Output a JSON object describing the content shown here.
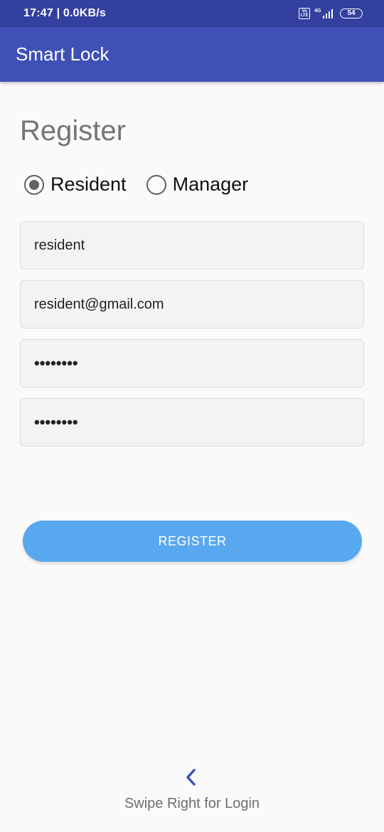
{
  "status_bar": {
    "time_speed": "17:47 | 0.0KB/s",
    "volte_top": "Vo",
    "volte_bottom": "LTE",
    "network": "4G",
    "battery": "54"
  },
  "app_bar": {
    "title": "Smart Lock"
  },
  "page": {
    "title": "Register"
  },
  "role_selector": {
    "options": [
      {
        "label": "Resident",
        "selected": true
      },
      {
        "label": "Manager",
        "selected": false
      }
    ]
  },
  "form": {
    "username": "resident",
    "email": "resident@gmail.com",
    "password": "••••••••",
    "confirm_password": "••••••••"
  },
  "register_button": {
    "label": "REGISTER"
  },
  "footer": {
    "hint": "Swipe Right for Login",
    "icon": "chevron-left-icon"
  },
  "colors": {
    "status_bar": "#33409f",
    "app_bar": "#3f51b5",
    "button": "#58a8f0"
  }
}
